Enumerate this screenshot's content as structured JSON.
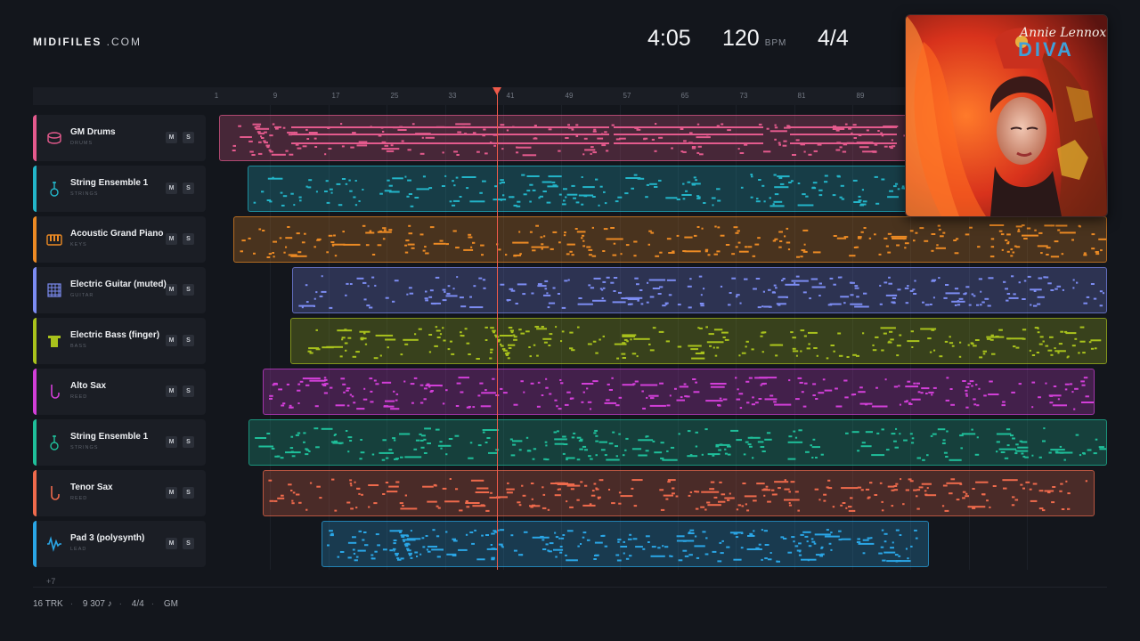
{
  "brand": {
    "name": "MIDIFILES",
    "suffix": " .COM"
  },
  "header": {
    "duration": "4:05",
    "tempo": "120",
    "tempo_unit": "BPM",
    "meter": "4/4"
  },
  "ruler": {
    "ticks": [
      "1",
      "9",
      "17",
      "25",
      "33",
      "41",
      "49",
      "57",
      "65",
      "73",
      "81",
      "89"
    ]
  },
  "album": {
    "artist_script": "Annie Lennox",
    "title": "DIVA"
  },
  "tracks": [
    {
      "name": "GM Drums",
      "category": "DRUMS",
      "color": "#e45a8d",
      "icon": "drum-icon",
      "mute": "M",
      "solo": "S"
    },
    {
      "name": "String Ensemble 1",
      "category": "STRINGS",
      "color": "#23b5c9",
      "icon": "violin-icon",
      "mute": "M",
      "solo": "S"
    },
    {
      "name": "Acoustic Grand Piano",
      "category": "KEYS",
      "color": "#ec8a24",
      "icon": "piano-keys-icon",
      "mute": "M",
      "solo": "S"
    },
    {
      "name": "Electric Guitar (muted)",
      "category": "GUITAR",
      "color": "#7c8cf2",
      "icon": "guitar-fretboard-icon",
      "mute": "M",
      "solo": "S"
    },
    {
      "name": "Electric Bass (finger)",
      "category": "BASS",
      "color": "#a9c21c",
      "icon": "bass-amp-icon",
      "mute": "M",
      "solo": "S"
    },
    {
      "name": "Alto Sax",
      "category": "REED",
      "color": "#d23fd8",
      "icon": "saxophone-icon",
      "mute": "M",
      "solo": "S"
    },
    {
      "name": "String Ensemble 1",
      "category": "STRINGS",
      "color": "#1fbf9a",
      "icon": "violin-icon",
      "mute": "M",
      "solo": "S"
    },
    {
      "name": "Tenor Sax",
      "category": "REED",
      "color": "#ef6a4c",
      "icon": "saxophone-icon",
      "mute": "M",
      "solo": "S"
    },
    {
      "name": "Pad 3 (polysynth)",
      "category": "LEAD",
      "color": "#2aa6e6",
      "icon": "waveform-icon",
      "mute": "M",
      "solo": "S"
    }
  ],
  "more_tracks": "+7",
  "footer": {
    "tracks": "16 TRK",
    "notes": "9 307 ♪",
    "meter": "4/4",
    "standard": "GM"
  }
}
